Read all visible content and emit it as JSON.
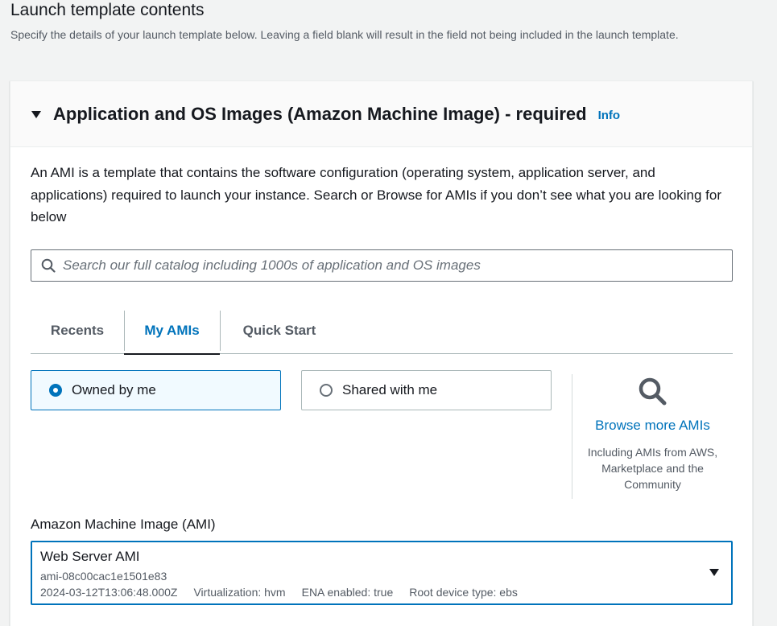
{
  "page": {
    "title": "Launch template contents",
    "description": "Specify the details of your launch template below. Leaving a field blank will result in the field not being included in the launch template."
  },
  "section": {
    "title": "Application and OS Images (Amazon Machine Image) - required",
    "info_label": "Info",
    "description": "An AMI is a template that contains the software configuration (operating system, application server, and applications) required to launch your instance. Search or Browse for AMIs if you don’t see what you are looking for below"
  },
  "search": {
    "placeholder": "Search our full catalog including 1000s of application and OS images",
    "value": ""
  },
  "tabs": [
    {
      "label": "Recents",
      "active": false
    },
    {
      "label": "My AMIs",
      "active": true
    },
    {
      "label": "Quick Start",
      "active": false
    }
  ],
  "ownership": {
    "options": [
      {
        "label": "Owned by me",
        "selected": true
      },
      {
        "label": "Shared with me",
        "selected": false
      }
    ]
  },
  "browse": {
    "link": "Browse more AMIs",
    "description": "Including AMIs from AWS, Marketplace and the Community"
  },
  "ami": {
    "label": "Amazon Machine Image (AMI)",
    "name": "Web Server AMI",
    "id": "ami-08c00cac1e1501e83",
    "created": "2024-03-12T13:06:48.000Z",
    "virtualization": "Virtualization: hvm",
    "ena": "ENA enabled: true",
    "root_device": "Root device type: ebs"
  },
  "colors": {
    "accent": "#0073bb",
    "background": "#f2f3f3",
    "selected_bg": "#f1faff"
  }
}
